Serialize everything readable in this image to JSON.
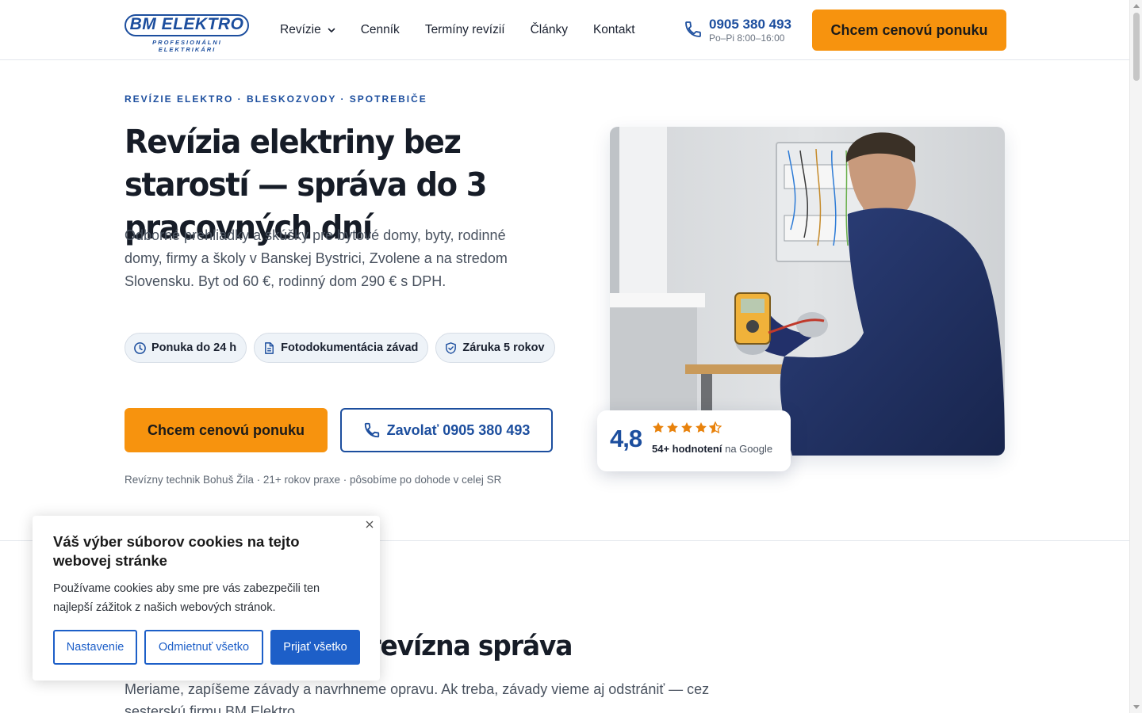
{
  "header": {
    "logo_text": "BM ELEKTRO",
    "logo_tagline": "PROFESIONÁLNI ELEKTRIKÁRI",
    "nav": [
      {
        "label": "Revízie",
        "has_dropdown": true
      },
      {
        "label": "Cenník"
      },
      {
        "label": "Termíny revízií"
      },
      {
        "label": "Články"
      },
      {
        "label": "Kontakt"
      }
    ],
    "phone": "0905 380 493",
    "hours": "Po–Pi 8:00–16:00",
    "cta": "Chcem cenovú ponuku"
  },
  "hero": {
    "eyebrow": "REVÍZIE ELEKTRO · BLESKOZVODY · SPOTREBIČE",
    "title": "Revízia elektriny bez starostí — správa do 3 pracovných dní",
    "description": "Odborné prehliadky a skúšky pre bytové domy, byty, rodinné domy, firmy a školy v Banskej Bystrici, Zvolene a na stredom Slovensku. Byt od 60 €, rodinný dom 290 € s DPH.",
    "chips": [
      {
        "icon": "clock-icon",
        "label": "Ponuka do 24 h"
      },
      {
        "icon": "document-icon",
        "label": "Fotodokumentácia závad"
      },
      {
        "icon": "shield-check-icon",
        "label": "Záruka 5 rokov"
      }
    ],
    "cta_primary": "Chcem cenovú ponuku",
    "cta_secondary": "Zavolať 0905 380 493",
    "note": "Revízny technik Bohuš Žila · 21+ rokov praxe · pôsobíme po dohode v celej SR"
  },
  "rating": {
    "score": "4,8",
    "stars": 4.5,
    "count_label": "54+ hodnotení",
    "source_label": "na Google"
  },
  "section": {
    "title": "revízna správa",
    "description": "Meriame, zapíšeme závady a navrhneme opravu. Ak treba, závady vieme aj odstrániť — cez sesterskú firmu BM Elektro."
  },
  "cookie": {
    "title": "Váš výber súborov cookies na tejto webovej stránke",
    "text": "Používame cookies aby sme pre vás zabezpečili ten najlepší zážitok z našich webových stránok.",
    "btn_settings": "Nastavenie",
    "btn_reject": "Odmietnuť všetko",
    "btn_accept": "Prijať všetko"
  },
  "colors": {
    "brand_blue": "#1c4e9e",
    "accent_orange": "#f7930e",
    "cookie_blue": "#1d5fc8",
    "star_orange": "#e8820c"
  }
}
